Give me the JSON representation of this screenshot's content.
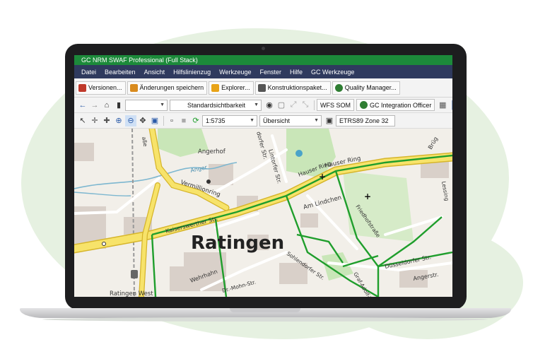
{
  "window": {
    "title": "GC NRM SWAF Professional (Full Stack)"
  },
  "menu": [
    "Datei",
    "Bearbeiten",
    "Ansicht",
    "Hilfslinienzug",
    "Werkzeuge",
    "Fenster",
    "Hilfe",
    "GC Werkzeuge"
  ],
  "ribbon": [
    {
      "label": "Versionen...",
      "icon": "versions-icon",
      "color": "#c0392b"
    },
    {
      "label": "Änderungen speichern",
      "icon": "save-icon",
      "color": "#d98b1e"
    },
    {
      "label": "Explorer...",
      "icon": "folder-icon",
      "color": "#e8a317"
    },
    {
      "label": "Konstruktionspaket...",
      "icon": "package-icon",
      "color": "#555555"
    },
    {
      "label": "Quality Manager...",
      "icon": "quality-icon",
      "color": "#2e7d32"
    }
  ],
  "navbar": {
    "view_select": "Standardsichtbarkeit",
    "wfs_button": "WFS SOM",
    "integration_button": "GC Integration Officer"
  },
  "toolbar": {
    "scale": "1:5735",
    "overview": "Übersicht",
    "crs": "ETRS89 Zone 32"
  },
  "map": {
    "labels": {
      "city": "Ratingen",
      "kaiserswerther": "Kaiserswerther Str.",
      "vermillionring": "Vermillionring",
      "hauser_ring": "Hauser Ring",
      "hauser_ring2": "Hauser Ring",
      "angerhof": "Angerhof",
      "anger": "Anger",
      "am_lindchen": "Am Lindchen",
      "lintorfer": "Lintorfer Str.",
      "dorfer": "dorfer Str.",
      "bahnhof": "Ratingen West",
      "wehrhahn": "Wehrhahn",
      "mohn": "Dr.-Mohn-Str.",
      "dusseldorfer": "Düsseldorfer Str.",
      "sohlendorfer": "Sohlendorfer Str.",
      "angerstr": "Angerstr.",
      "graf": "Graf-Adolf-Str.",
      "bruegel": "Brüg",
      "strasse": "aße",
      "kaiserswerther2": "Kaiserswerther Str.",
      "lessing": "Lessing",
      "friedhofstr": "Friedhofstraße"
    },
    "colors": {
      "road": "#f7e36a",
      "road_edge": "#d6b52b",
      "network": "#1f9e2c",
      "water": "#aad3df",
      "park": "#c9e6b8",
      "building": "#d9d0c9",
      "land": "#f2efe9"
    }
  }
}
